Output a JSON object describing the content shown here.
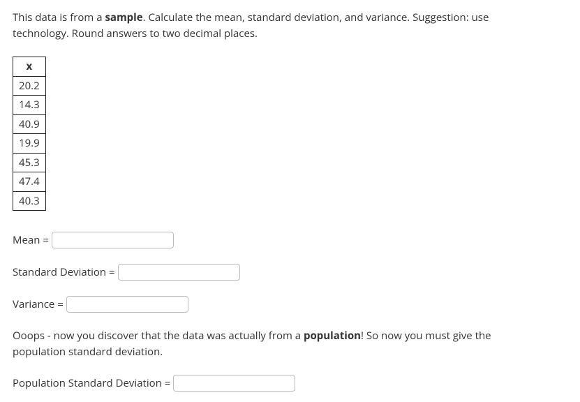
{
  "prompt": {
    "pre": "This data is from a ",
    "bold1": "sample",
    "post": ". Calculate the mean, standard deviation, and variance. Suggestion: use technology. Round answers to two decimal places."
  },
  "table": {
    "header": "x",
    "rows": [
      "20.2",
      "14.3",
      "40.9",
      "19.9",
      "45.3",
      "47.4",
      "40.3"
    ]
  },
  "fields": {
    "mean_label": "Mean =",
    "mean_value": "",
    "sd_label": "Standard Deviation =",
    "sd_value": "",
    "var_label": "Variance =",
    "var_value": "",
    "psd_label": "Population Standard Deviation =",
    "psd_value": ""
  },
  "ooops": {
    "pre": "Ooops - now you discover that the data was actually from a ",
    "bold": "population",
    "post": "! So now you must give the population standard deviation."
  }
}
